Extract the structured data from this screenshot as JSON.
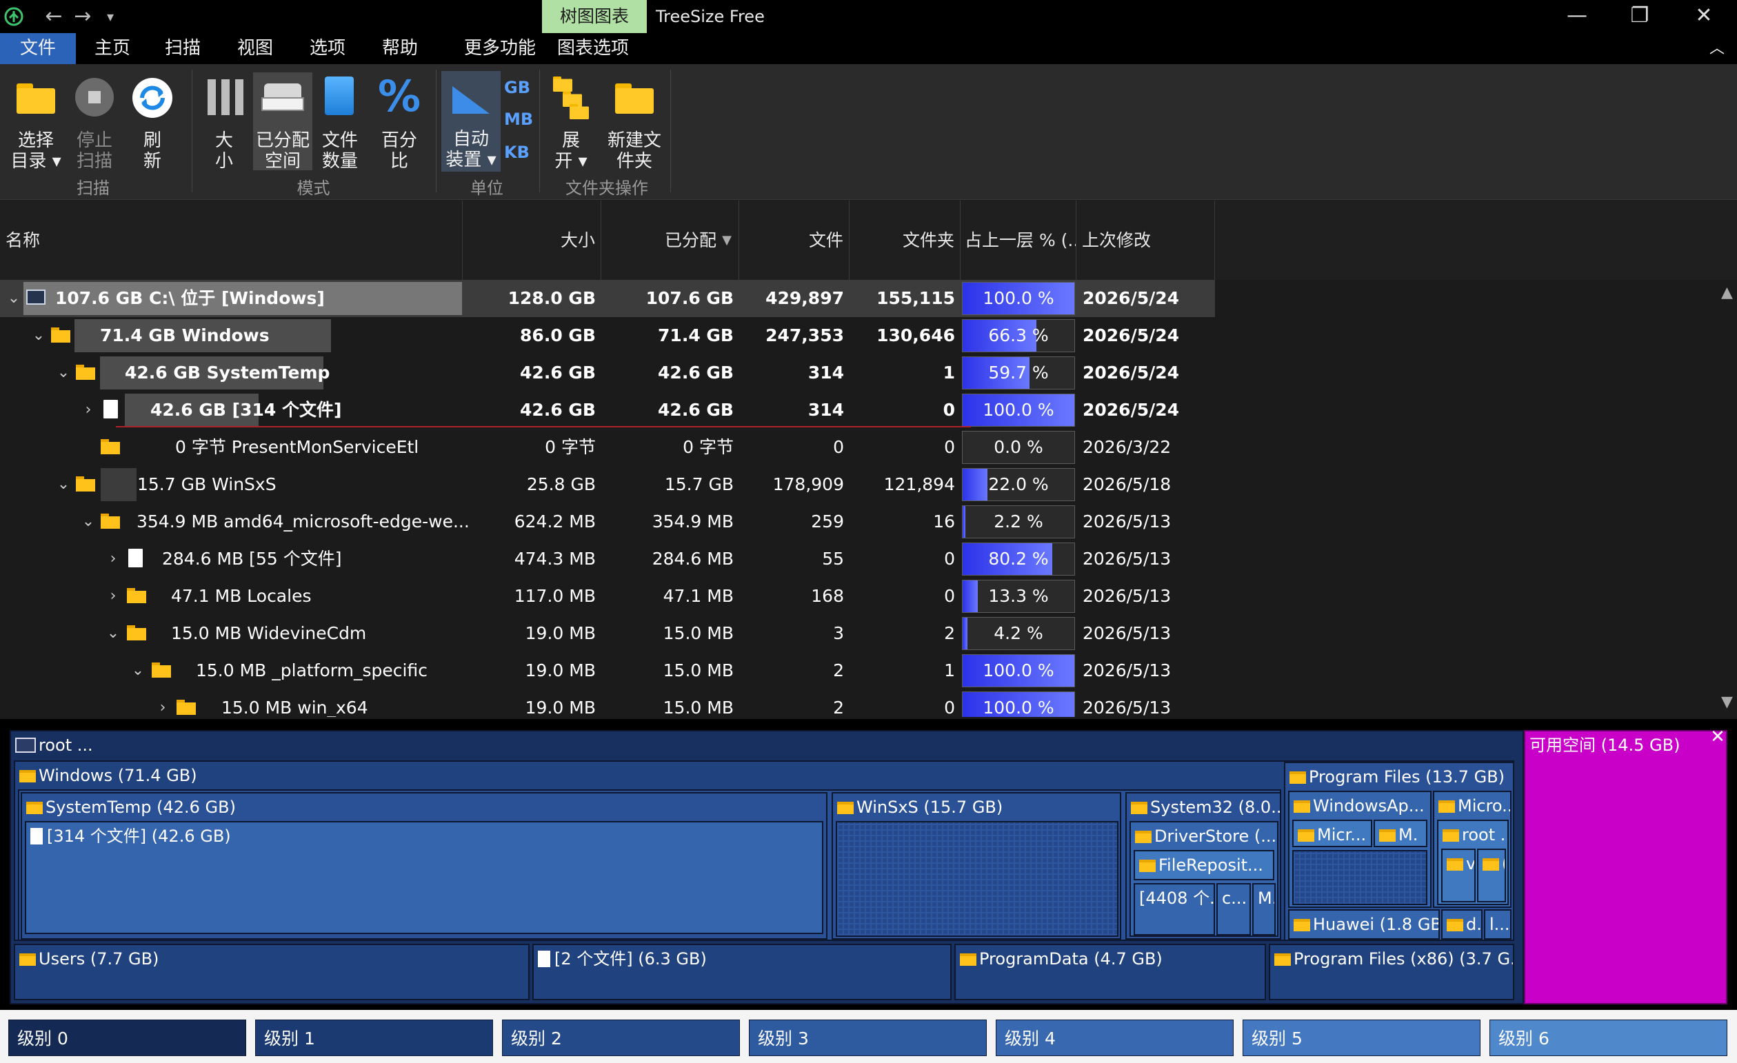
{
  "titlebar": {
    "context_tab": "树图图表",
    "app_title": "TreeSize Free",
    "minimize": "—",
    "maximize": "❐",
    "close": "✕"
  },
  "menu": [
    "文件",
    "主页",
    "扫描",
    "视图",
    "选项",
    "帮助",
    "更多功能",
    "图表选项"
  ],
  "ribbon": {
    "scan": {
      "select_dir": "选择\n目录 ▾",
      "stop_scan": "停止\n扫描",
      "refresh": "刷\n新",
      "group": "扫描"
    },
    "mode": {
      "size": "大\n小",
      "allocated": "已分配\n空间",
      "file_count": "文件\n数量",
      "percent": "百分\n比",
      "group": "模式"
    },
    "unit": {
      "auto": "自动\n装置 ▾",
      "gb": "GB",
      "mb": "MB",
      "kb": "KB",
      "group": "单位"
    },
    "folder_ops": {
      "expand": "展\n开 ▾",
      "new_folder": "新建文\n件夹",
      "group": "文件夹操作"
    }
  },
  "columns": {
    "name": "名称",
    "size": "大小",
    "allocated": "已分配",
    "files": "文件",
    "folders": "文件夹",
    "percent_parent": "占上一层 % (...",
    "last_modified": "上次修改"
  },
  "rows": [
    {
      "name": "107.6 GB   C:\\  位于  [Windows]",
      "size": "128.0 GB",
      "allocated": "107.6 GB",
      "files": "429,897",
      "folders": "155,115",
      "pct_text": "100.0 %",
      "pct": 100.0,
      "modified": "2026/5/24"
    },
    {
      "name": "71.4 GB   Windows",
      "size": "86.0 GB",
      "allocated": "71.4 GB",
      "files": "247,353",
      "folders": "130,646",
      "pct_text": "66.3 %",
      "pct": 66.3,
      "modified": "2026/5/24"
    },
    {
      "name": "42.6 GB   SystemTemp",
      "size": "42.6 GB",
      "allocated": "42.6 GB",
      "files": "314",
      "folders": "1",
      "pct_text": "59.7 %",
      "pct": 59.7,
      "modified": "2026/5/24"
    },
    {
      "name": "42.6 GB   [314 个文件]",
      "size": "42.6 GB",
      "allocated": "42.6 GB",
      "files": "314",
      "folders": "0",
      "pct_text": "100.0 %",
      "pct": 100.0,
      "modified": "2026/5/24"
    },
    {
      "name": "0 字节   PresentMonServiceEtl",
      "size": "0 字节",
      "allocated": "0 字节",
      "files": "0",
      "folders": "0",
      "pct_text": "0.0 %",
      "pct": 0.0,
      "modified": "2026/3/22"
    },
    {
      "name": "15.7 GB   WinSxS",
      "size": "25.8 GB",
      "allocated": "15.7 GB",
      "files": "178,909",
      "folders": "121,894",
      "pct_text": "22.0 %",
      "pct": 22.0,
      "modified": "2026/5/18"
    },
    {
      "name": "354.9 MB   amd64_microsoft-edge-we...",
      "size": "624.2 MB",
      "allocated": "354.9 MB",
      "files": "259",
      "folders": "16",
      "pct_text": "2.2 %",
      "pct": 2.2,
      "modified": "2026/5/13"
    },
    {
      "name": "284.6 MB   [55 个文件]",
      "size": "474.3 MB",
      "allocated": "284.6 MB",
      "files": "55",
      "folders": "0",
      "pct_text": "80.2 %",
      "pct": 80.2,
      "modified": "2026/5/13"
    },
    {
      "name": "47.1 MB   Locales",
      "size": "117.0 MB",
      "allocated": "47.1 MB",
      "files": "168",
      "folders": "0",
      "pct_text": "13.3 %",
      "pct": 13.3,
      "modified": "2026/5/13"
    },
    {
      "name": "15.0 MB   WidevineCdm",
      "size": "19.0 MB",
      "allocated": "15.0 MB",
      "files": "3",
      "folders": "2",
      "pct_text": "4.2 %",
      "pct": 4.2,
      "modified": "2026/5/13"
    },
    {
      "name": "15.0 MB   _platform_specific",
      "size": "19.0 MB",
      "allocated": "15.0 MB",
      "files": "2",
      "folders": "1",
      "pct_text": "100.0 %",
      "pct": 100.0,
      "modified": "2026/5/13"
    },
    {
      "name": "15.0 MB   win_x64",
      "size": "19.0 MB",
      "allocated": "15.0 MB",
      "files": "2",
      "folders": "0",
      "pct_text": "100.0 %",
      "pct": 100.0,
      "modified": "2026/5/13"
    }
  ],
  "treemap": {
    "root": "root ...",
    "windows": "Windows (71.4 GB)",
    "systemtemp": "SystemTemp (42.6 GB)",
    "files314": "[314 个文件] (42.6 GB)",
    "winsxs": "WinSxS (15.7 GB)",
    "system32": "System32 (8.0...",
    "driverstore": "DriverStore (...",
    "filerepo": "FileReposit...",
    "files4408": "[4408 个...",
    "c_short": "c...",
    "m_short": "M.",
    "programfiles": "Program Files (13.7 GB)",
    "windowsapps": "WindowsAp...",
    "micro": "Micro...",
    "micr": "Micr...",
    "m2": "M.",
    "v": "v",
    "c2": "(",
    "huawei": "Huawei (1.8 GB)",
    "d": "d...",
    "l": "l...",
    "users": "Users (7.7 GB)",
    "files2": "[2 个文件] (6.3 GB)",
    "programdata": "ProgramData (4.7 GB)",
    "programfilesx86": "Program Files (x86) (3.7 G...",
    "free": "可用空间 (14.5 GB)",
    "close": "✕"
  },
  "levels": [
    "级别 0",
    "级别 1",
    "级别 2",
    "级别 3",
    "级别 4",
    "级别 5",
    "级别 6"
  ],
  "colors": {
    "accent": "#2b63b9",
    "context_tab": "#b0e0a4",
    "pct_bar": "#3a44f0",
    "free_space": "#c800c8",
    "level_colors": [
      "#142a55",
      "#1c3a72",
      "#244a8a",
      "#2e5aa0",
      "#3868b0",
      "#4478c0",
      "#5088cc"
    ]
  }
}
